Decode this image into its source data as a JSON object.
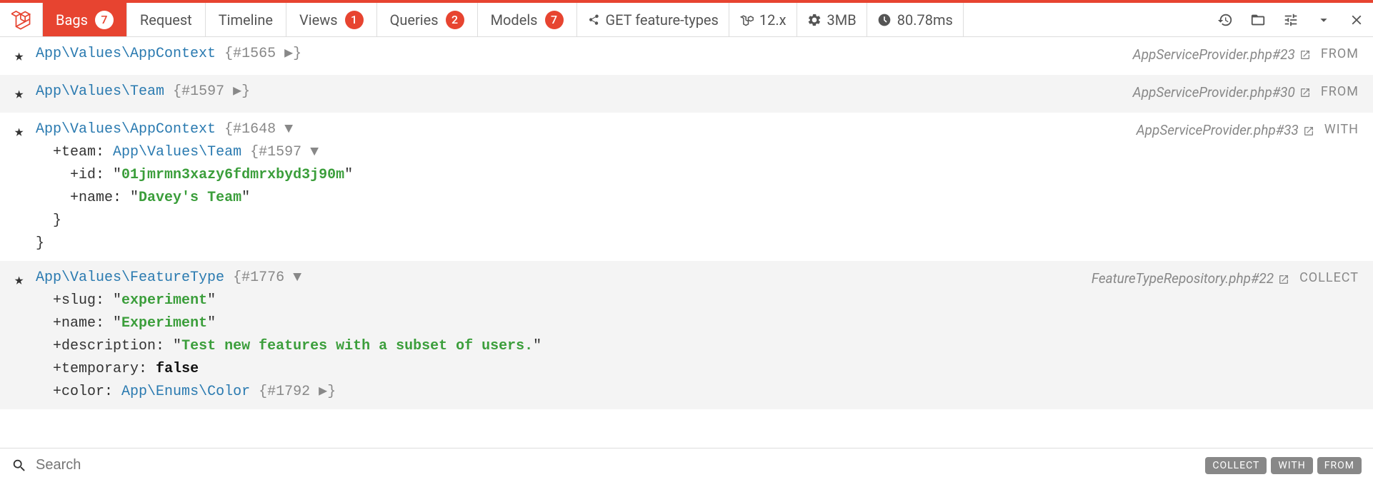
{
  "tabs": {
    "bags": {
      "label": "Bags",
      "count": "7"
    },
    "request": {
      "label": "Request"
    },
    "timeline": {
      "label": "Timeline"
    },
    "views": {
      "label": "Views",
      "count": "1"
    },
    "queries": {
      "label": "Queries",
      "count": "2"
    },
    "models": {
      "label": "Models",
      "count": "7"
    }
  },
  "info": {
    "route": "GET feature-types",
    "version": "12.x",
    "memory": "3MB",
    "time": "80.78ms"
  },
  "rows": [
    {
      "class": "App\\Values\\AppContext",
      "ref": "#1565",
      "expanded": false,
      "src": "AppServiceProvider.php#23",
      "tag": "FROM"
    },
    {
      "class": "App\\Values\\Team",
      "ref": "#1597",
      "expanded": false,
      "src": "AppServiceProvider.php#30",
      "tag": "FROM"
    },
    {
      "class": "App\\Values\\AppContext",
      "ref": "#1648",
      "expanded": true,
      "children": {
        "team": {
          "class": "App\\Values\\Team",
          "ref": "#1597",
          "expanded": true,
          "props": {
            "id": "01jmrmn3xazy6fdmrxbyd3j90m",
            "name": "Davey's Team"
          }
        }
      },
      "src": "AppServiceProvider.php#33",
      "tag": "WITH"
    },
    {
      "class": "App\\Values\\FeatureType",
      "ref": "#1776",
      "expanded": true,
      "props": {
        "slug": "experiment",
        "name": "Experiment",
        "description": "Test new features with a subset of users.",
        "temporary": "false",
        "color": {
          "class": "App\\Enums\\Color",
          "ref": "#1792"
        }
      },
      "src": "FeatureTypeRepository.php#22",
      "tag": "COLLECT"
    }
  ],
  "search": {
    "placeholder": "Search"
  },
  "filters": [
    "COLLECT",
    "WITH",
    "FROM"
  ]
}
